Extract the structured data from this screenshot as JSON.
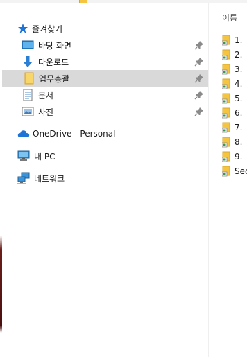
{
  "nav": {
    "quick_access": {
      "label": "즐겨찾기",
      "icon": "star-icon"
    },
    "pinned": [
      {
        "label": "바탕 화면",
        "icon": "desktop-icon",
        "pinned": true
      },
      {
        "label": "다운로드",
        "icon": "download-icon",
        "pinned": true
      },
      {
        "label": "업무총괄",
        "icon": "folder-icon",
        "pinned": true,
        "selected": true
      },
      {
        "label": "문서",
        "icon": "document-icon",
        "pinned": true
      },
      {
        "label": "사진",
        "icon": "pictures-icon",
        "pinned": true
      }
    ],
    "onedrive": {
      "label": "OneDrive - Personal",
      "icon": "cloud-icon"
    },
    "this_pc": {
      "label": "내 PC",
      "icon": "computer-icon"
    },
    "network": {
      "label": "네트워크",
      "icon": "network-icon"
    }
  },
  "content": {
    "column_header": "이름",
    "files": [
      {
        "name": "1. "
      },
      {
        "name": "2. "
      },
      {
        "name": "3. "
      },
      {
        "name": "4. "
      },
      {
        "name": "5. "
      },
      {
        "name": "6. "
      },
      {
        "name": "7. "
      },
      {
        "name": "8. "
      },
      {
        "name": "9. "
      },
      {
        "name": "Sec"
      }
    ]
  },
  "colors": {
    "selection": "#d9d9d9",
    "folder": "#f5c542",
    "accent": "#1e73d6"
  }
}
